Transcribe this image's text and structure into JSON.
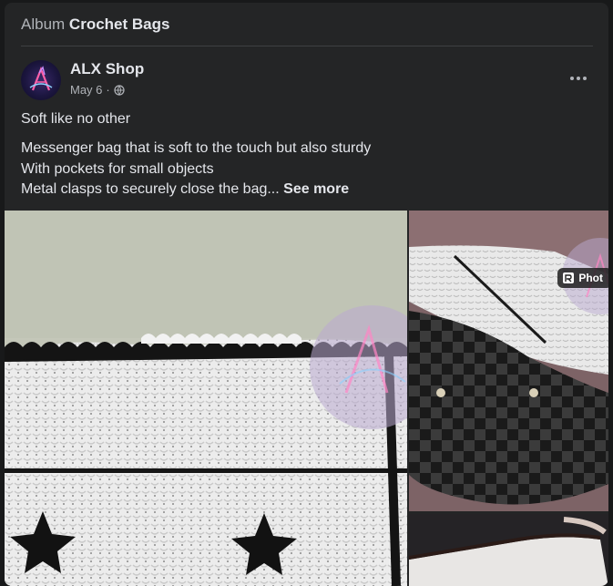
{
  "album": {
    "prefix": "Album",
    "title": "Crochet Bags"
  },
  "post": {
    "page_name": "ALX Shop",
    "date": "May 6",
    "meta_separator": "·",
    "title": "Soft like no other",
    "lines": [
      "Messenger bag that is soft to the touch but also sturdy",
      "With pockets for small objects",
      "Metal clasps to securely close the bag..."
    ],
    "see_more": "See more"
  },
  "photos": {
    "badge_label": "Phot"
  },
  "icons": {
    "avatar": "shop-logo-avatar",
    "globe": "globe-icon",
    "more": "more-horizontal-icon",
    "photos_badge": "photo-icon"
  },
  "colors": {
    "card_background": "#242526",
    "page_background": "#18191a",
    "primary_text": "#e4e6eb",
    "secondary_text": "#b0b3b8"
  }
}
